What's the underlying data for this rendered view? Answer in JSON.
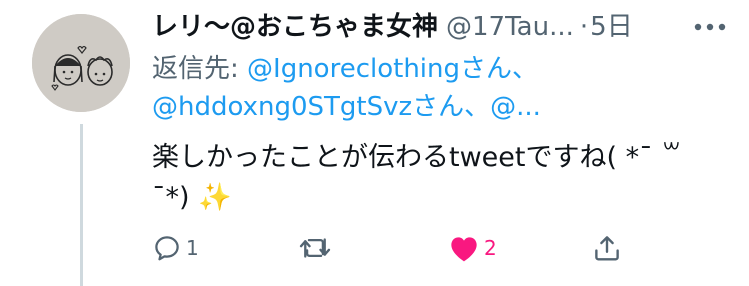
{
  "tweet": {
    "display_name": "レリ〜@おこちゃま女神",
    "handle": "@17Tau...",
    "separator": "·",
    "time": "5日",
    "reply_prefix": "返信先: ",
    "reply_mention_1": "@Ignoreclothing",
    "reply_suffix_1": "さん、",
    "reply_mention_2": "@hddoxng0STgtSvz",
    "reply_suffix_2": "さん、",
    "reply_mention_3": "@...",
    "text_line1": "楽しかったことが伝わるtweetですね( *¯ ꒳",
    "text_line2": "¯*)",
    "text_emoji": "✨",
    "reply_count": "1",
    "retweet_count": "",
    "like_count": "2",
    "liked": true
  },
  "icons": [
    "more-icon",
    "reply-icon",
    "retweet-icon",
    "like-icon",
    "share-icon"
  ],
  "colors": {
    "accent": "#1d9bf0",
    "muted": "#536471",
    "like": "#f91880",
    "text": "#0f1419"
  }
}
